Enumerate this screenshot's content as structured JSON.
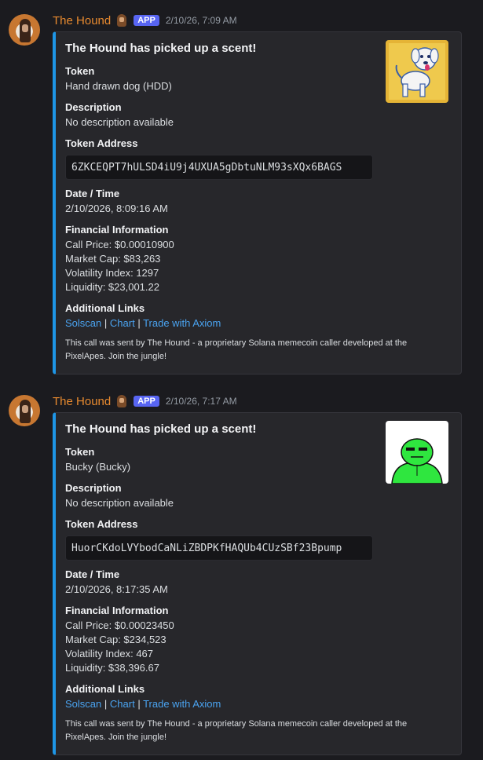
{
  "messages": [
    {
      "username": "The Hound",
      "badge": "APP",
      "timestamp": "2/10/26, 7:09 AM",
      "embed": {
        "title": "The Hound has picked up a scent!",
        "token_label": "Token",
        "token_value": "Hand drawn dog (HDD)",
        "description_label": "Description",
        "description_value": "No description available",
        "address_label": "Token Address",
        "address_value": "6ZKCEQPT7hULSD4iU9j4UXUA5gDbtuNLM93sXQx6BAGS",
        "date_label": "Date / Time",
        "date_value": "2/10/2026, 8:09:16 AM",
        "financial_label": "Financial Information",
        "call_price": "Call Price: $0.00010900",
        "market_cap": "Market Cap: $83,263",
        "volatility": "Volatility Index: 1297",
        "liquidity": "Liquidity: $23,001.22",
        "links_label": "Additional Links",
        "link_solscan": "Solscan",
        "link_chart": "Chart",
        "link_axiom": "Trade with Axiom",
        "sep": "|",
        "footer": "This call was sent by The Hound - a proprietary Solana memecoin caller developed at the PixelApes. Join the jungle!",
        "thumbnail": "dog-drawing"
      }
    },
    {
      "username": "The Hound",
      "badge": "APP",
      "timestamp": "2/10/26, 7:17 AM",
      "embed": {
        "title": "The Hound has picked up a scent!",
        "token_label": "Token",
        "token_value": "Bucky (Bucky)",
        "description_label": "Description",
        "description_value": "No description available",
        "address_label": "Token Address",
        "address_value": "HuorCKdoLVYbodCaNLiZBDPKfHAQUb4CUzSBf23Bpump",
        "date_label": "Date / Time",
        "date_value": "2/10/2026, 8:17:35 AM",
        "financial_label": "Financial Information",
        "call_price": "Call Price: $0.00023450",
        "market_cap": "Market Cap: $234,523",
        "volatility": "Volatility Index: 467",
        "liquidity": "Liquidity: $38,396.67",
        "links_label": "Additional Links",
        "link_solscan": "Solscan",
        "link_chart": "Chart",
        "link_axiom": "Trade with Axiom",
        "sep": "|",
        "footer": "This call was sent by The Hound - a proprietary Solana memecoin caller developed at the PixelApes. Join the jungle!",
        "thumbnail": "green-frog"
      }
    }
  ],
  "colors": {
    "accent_bar": "#1e96e6",
    "username": "#e88a2f",
    "link": "#4aa3f0",
    "app_badge": "#5865f2"
  }
}
